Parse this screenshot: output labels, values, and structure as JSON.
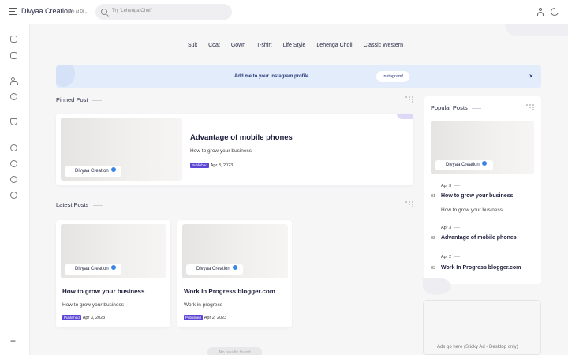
{
  "header": {
    "brand": "Divyaa Creation",
    "tagline": "We at Di...",
    "search_placeholder": "Try 'Lehenga Choli'"
  },
  "nav": {
    "items": [
      "Suit",
      "Coat",
      "Gown",
      "T-shirt",
      "Life Style",
      "Lehenga Choli",
      "Classic Western"
    ]
  },
  "banner": {
    "text": "Add me to your Instagram profile",
    "button": "Instagram!",
    "close": "×"
  },
  "pinned": {
    "section_title": "Pinned Post",
    "post": {
      "title": "Advantage of mobile phones",
      "excerpt": "How to grow your business",
      "status": "Published",
      "date": "Apr 3, 2023",
      "author": "Divyaa Creation"
    }
  },
  "latest": {
    "section_title": "Latest Posts",
    "posts": [
      {
        "title": "How to grow your business",
        "excerpt": "How to grow your business",
        "status": "Published",
        "date": "Apr 3, 2023",
        "author": "Divyaa Creation"
      },
      {
        "title": "Work In Progress blogger.com",
        "excerpt": "Work in progress",
        "status": "Published",
        "date": "Apr 2, 2023",
        "author": "Divyaa Creation"
      }
    ]
  },
  "popular": {
    "section_title": "Popular Posts",
    "author": "Divyaa Creation",
    "items": [
      {
        "date": "Apr 3",
        "num": "01",
        "title": "How to grow your business",
        "excerpt": "How to grow your business"
      },
      {
        "date": "Apr 3",
        "num": "02",
        "title": "Advantage of mobile phones",
        "excerpt": ""
      },
      {
        "date": "Apr 2",
        "num": "03",
        "title": "Work In Progress blogger.com",
        "excerpt": ""
      }
    ]
  },
  "ad": {
    "text": "Ads go here (Sticky Ad - Desktop only)"
  },
  "pagination": {
    "no_results": "No results found"
  },
  "icons": {
    "menu": "hamburger-icon",
    "search": "search-icon",
    "user": "user-icon",
    "theme": "moon-icon",
    "sidebar": [
      "home-icon",
      "folder-icon",
      "people-icon",
      "smile-icon",
      "shield-icon",
      "folder-icon",
      "folder-icon",
      "folder-icon",
      "folder-icon"
    ],
    "add": "plus-icon"
  },
  "colors": {
    "accent": "#5c46d6",
    "banner_bg": "#e3ecfb",
    "verified": "#3a86e8"
  }
}
